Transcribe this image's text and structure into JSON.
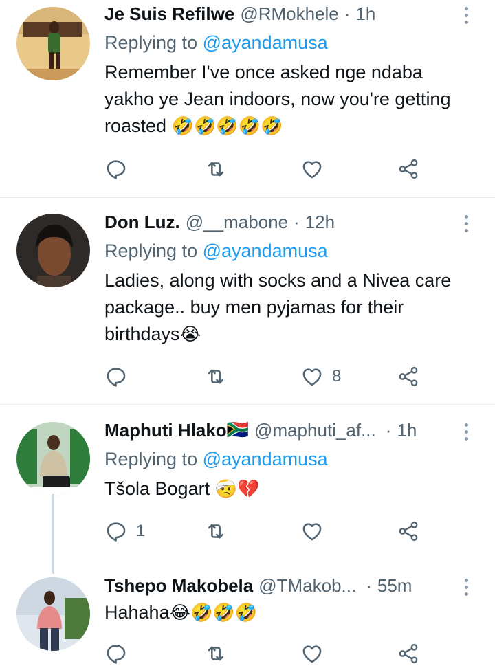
{
  "tweets": [
    {
      "name": "Je Suis Refilwe",
      "handle": "@RMokhele",
      "separator": "·",
      "time": "1h",
      "replying_prefix": "Replying to",
      "replying_to": "@ayandamusa",
      "text": "Remember I've once asked nge ndaba yakho ye Jean indoors, now you're getting roasted",
      "emoji": "🤣🤣🤣🤣🤣",
      "reply_count": "",
      "like_count": ""
    },
    {
      "name": "Don Luz.",
      "handle": "@__mabone",
      "separator": "·",
      "time": "12h",
      "replying_prefix": "Replying to",
      "replying_to": "@ayandamusa",
      "text": "Ladies, along with socks and a Nivea care package.. buy men pyjamas for their birthdays",
      "emoji": "😭",
      "reply_count": "",
      "like_count": "8"
    },
    {
      "name": "Maphuti Hlako",
      "name_emoji": "🇿🇦",
      "handle": "@maphuti_af...",
      "separator": "·",
      "time": "1h",
      "replying_prefix": "Replying to",
      "replying_to": "@ayandamusa",
      "text": "Tšola Bogart ",
      "emoji": "🤕💔",
      "reply_count": "1",
      "like_count": ""
    },
    {
      "name": "Tshepo Makobela",
      "handle": "@TMakob...",
      "separator": "·",
      "time": "55m",
      "text": "Hahaha",
      "emoji": "😂🤣🤣🤣",
      "reply_count": "",
      "like_count": ""
    }
  ],
  "colors": {
    "accent": "#1d9bf0",
    "secondary_text": "#536471",
    "divider": "#e6e9eb"
  },
  "icons": [
    "reply-icon",
    "retweet-icon",
    "like-icon",
    "share-icon",
    "more-icon"
  ]
}
